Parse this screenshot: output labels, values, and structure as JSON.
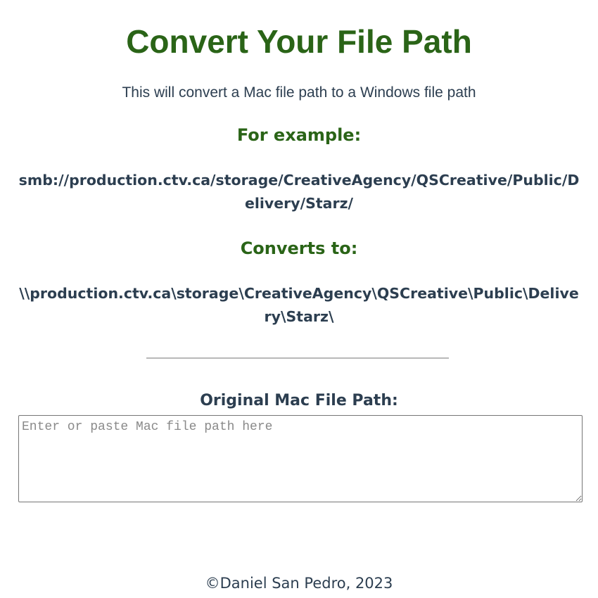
{
  "header": {
    "title": "Convert Your File Path",
    "subtitle": "This will convert a Mac file path to a Windows file path"
  },
  "example": {
    "heading": "For example:",
    "mac_path": "smb://production.ctv.ca/storage/CreativeAgency/QSCreative/Public/Delivery/Starz/",
    "converts_heading": "Converts to:",
    "windows_path": "\\\\production.ctv.ca\\storage\\CreativeAgency\\QSCreative\\Public\\Delivery\\Starz\\"
  },
  "form": {
    "label": "Original Mac File Path:",
    "input_value": "",
    "input_placeholder": "Enter or paste Mac file path here"
  },
  "footer": {
    "copyright": "©Daniel San Pedro, 2023"
  },
  "colors": {
    "accent_green": "#2a6417",
    "text_dark": "#2c3e50",
    "divider": "#b8b8b8"
  }
}
